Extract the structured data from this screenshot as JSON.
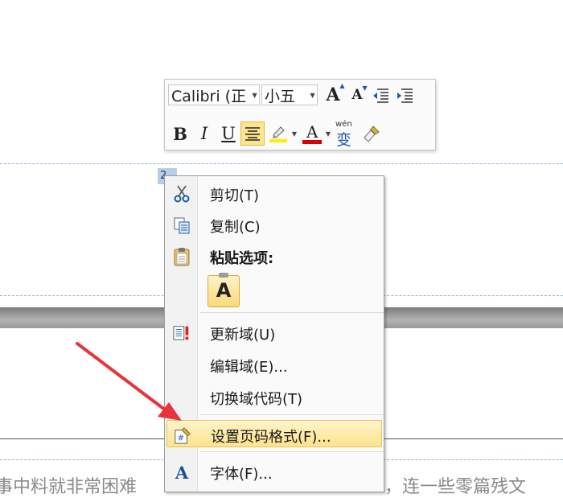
{
  "mini_toolbar": {
    "font_name": "Calibri (正",
    "font_size": "小五",
    "grow_font": "A",
    "shrink_font": "A",
    "bold": "B",
    "italic": "I",
    "underline": "U",
    "font_color_letter": "A",
    "phonetic_top": "wén",
    "phonetic_char": "变",
    "highlight_color": "#ffef00",
    "font_color": "#d60000"
  },
  "page_number": "2",
  "context_menu": {
    "items": [
      {
        "label": "剪切(T)",
        "icon": "scissors-icon"
      },
      {
        "label": "复制(C)",
        "icon": "copy-icon"
      },
      {
        "label": "粘贴选项:",
        "icon": "paste-icon"
      },
      {
        "label": "更新域(U)",
        "icon": "update-field-icon"
      },
      {
        "label": "编辑域(E)...",
        "icon": ""
      },
      {
        "label": "切换域代码(T)",
        "icon": ""
      },
      {
        "label": "设置页码格式(F)...",
        "icon": "page-number-format-icon"
      },
      {
        "label": "字体(F)...",
        "icon": "font-icon"
      }
    ],
    "paste_option_label": "A",
    "font_icon_letter": "A"
  },
  "document": {
    "body_text_left": "事中料就非常困难",
    "body_text_right": "，连一些零篇残文"
  },
  "colors": {
    "arrow": "#e8333a",
    "hover_item": "#fde38c",
    "header_dashed_line": "#8fb4d8"
  }
}
